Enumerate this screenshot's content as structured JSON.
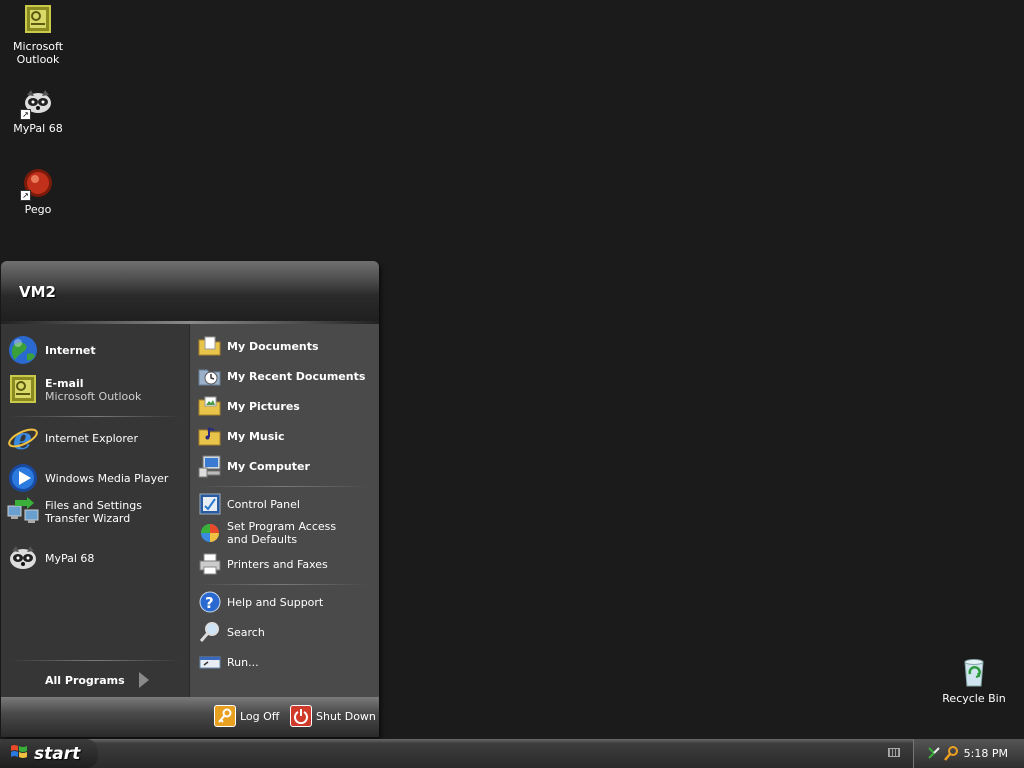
{
  "desktop": {
    "icons": [
      {
        "label": "Microsoft Outlook",
        "icon": "outlook-icon"
      },
      {
        "label": "MyPal 68",
        "icon": "mypal-icon"
      },
      {
        "label": "Pego",
        "icon": "pego-icon"
      },
      {
        "label": "Recycle Bin",
        "icon": "recycle-bin-icon"
      }
    ]
  },
  "start_menu": {
    "user": "VM2",
    "pinned": [
      {
        "label": "Internet",
        "icon": "globe-icon"
      },
      {
        "label": "E-mail",
        "sublabel": "Microsoft Outlook",
        "icon": "outlook-icon"
      }
    ],
    "recent": [
      {
        "label": "Internet Explorer",
        "icon": "ie-icon"
      },
      {
        "label": "Windows Media Player",
        "icon": "media-player-icon"
      },
      {
        "label": "Files and Settings Transfer Wizard",
        "icon": "transfer-wizard-icon"
      },
      {
        "label": "MyPal 68",
        "icon": "mypal-icon"
      }
    ],
    "all_programs": "All Programs",
    "places": [
      {
        "label": "My Documents",
        "icon": "folder-documents-icon"
      },
      {
        "label": "My Recent Documents",
        "icon": "recent-documents-icon"
      },
      {
        "label": "My Pictures",
        "icon": "folder-pictures-icon"
      },
      {
        "label": "My Music",
        "icon": "folder-music-icon"
      },
      {
        "label": "My Computer",
        "icon": "computer-icon"
      }
    ],
    "system": [
      {
        "label": "Control Panel",
        "icon": "control-panel-icon"
      },
      {
        "label": "Set Program Access and Defaults",
        "icon": "program-access-icon"
      },
      {
        "label": "Printers and Faxes",
        "icon": "printer-icon"
      }
    ],
    "tools": [
      {
        "label": "Help and Support",
        "icon": "help-icon"
      },
      {
        "label": "Search",
        "icon": "search-icon"
      },
      {
        "label": "Run...",
        "icon": "run-icon"
      }
    ],
    "footer": {
      "logoff": "Log Off",
      "shutdown": "Shut Down"
    }
  },
  "taskbar": {
    "start_label": "start",
    "clock": "5:18 PM"
  },
  "colors": {
    "desktop": "#1b1b1b",
    "logoff": "#e8a020",
    "shutdown": "#d03a2a"
  }
}
